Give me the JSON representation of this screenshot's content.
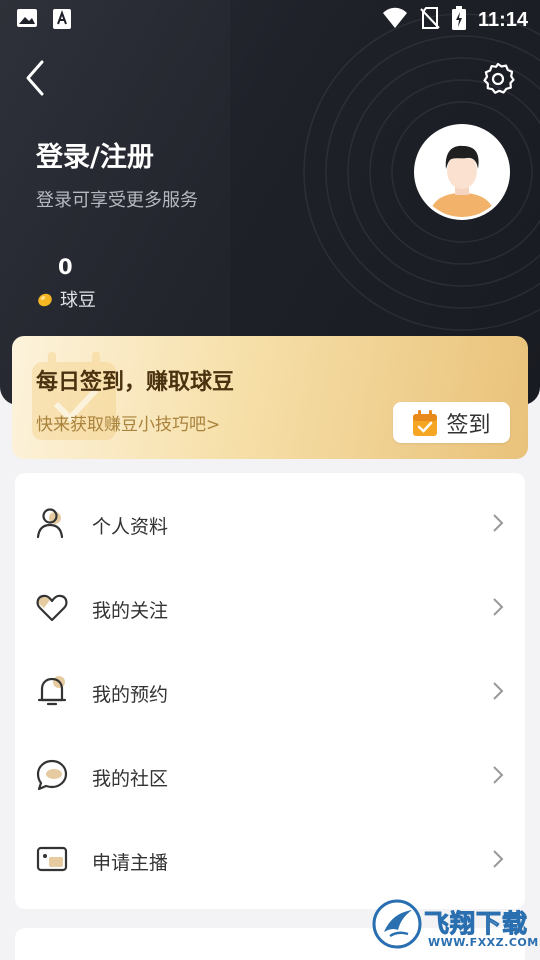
{
  "status_bar": {
    "time": "11:14",
    "left_icons": [
      "image-icon",
      "text-a-icon"
    ],
    "right_icons": [
      "wifi-icon",
      "no-sim-icon",
      "battery-charging-icon"
    ]
  },
  "header": {
    "back_icon": "chevron-left-icon",
    "settings_icon": "gear-icon",
    "login_title": "登录/注册",
    "login_subtitle": "登录可享受更多服务",
    "beans_count": "0",
    "beans_label": "球豆",
    "avatar_icon": "default-avatar"
  },
  "checkin": {
    "title": "每日签到，赚取球豆",
    "tip": "快来获取赚豆小技巧吧>",
    "button_label": "签到",
    "button_icon": "calendar-check-icon"
  },
  "menu": {
    "items": [
      {
        "label": "个人资料",
        "icon": "user-icon"
      },
      {
        "label": "我的关注",
        "icon": "heart-icon"
      },
      {
        "label": "我的预约",
        "icon": "bell-icon"
      },
      {
        "label": "我的社区",
        "icon": "chat-bubble-icon"
      },
      {
        "label": "申请主播",
        "icon": "id-card-icon"
      }
    ]
  },
  "watermark": {
    "text": "飞翔下载",
    "url": "WWW.FXXZ.COM"
  },
  "colors": {
    "header_bg": "#1f2129",
    "accent_gold": "#e9c27a",
    "checkin_title": "#4a3210",
    "checkin_tip": "#a9823c",
    "icon_accent": "#d9b37a"
  }
}
